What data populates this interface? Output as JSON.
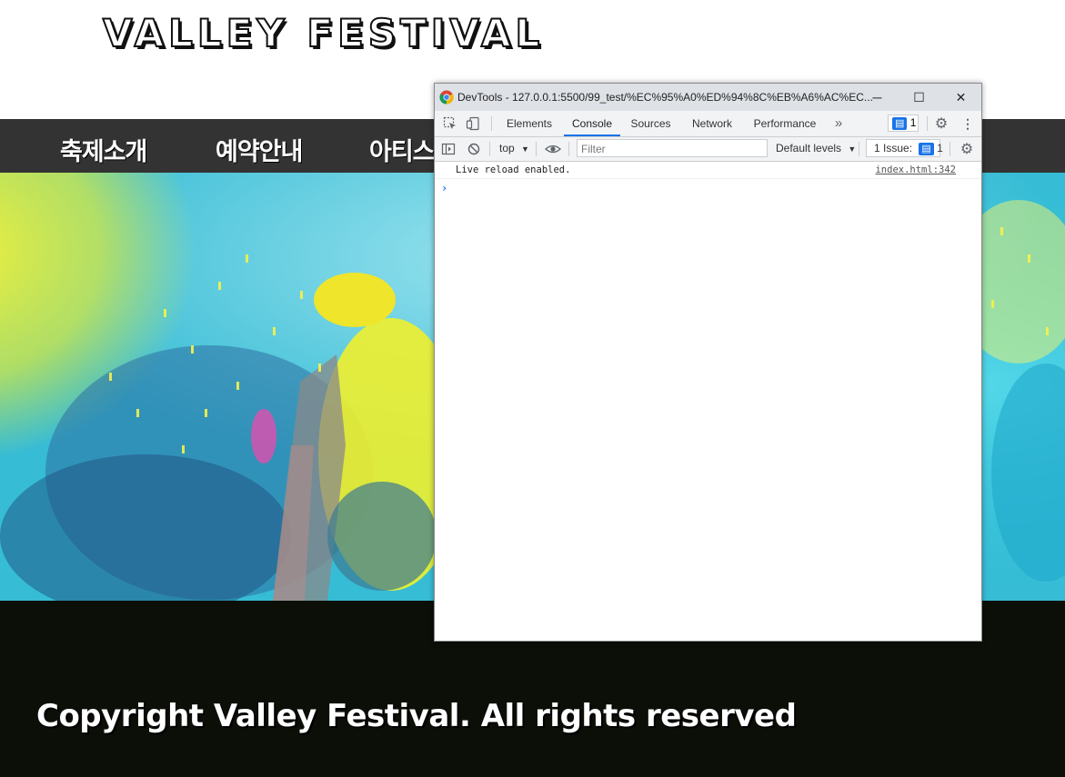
{
  "site": {
    "logo": "VALLEY FESTIVAL",
    "nav": [
      "축제소개",
      "예약안내",
      "아티스"
    ],
    "footer_text": "Copyright Valley Festival. All rights reserved",
    "colors": {
      "nav_bg": "#333333",
      "footer_bg": "#0b0f07",
      "hero_accent_yellow": "#e8ef2a",
      "hero_accent_cyan": "#2fbfd6"
    }
  },
  "devtools": {
    "title": "DevTools - 127.0.0.1:5500/99_test/%EC%95%A0%ED%94%8C%EB%A6%AC%EC...",
    "window_controls": {
      "minimize": "─",
      "maximize": "☐",
      "close": "✕"
    },
    "tabs": [
      "Elements",
      "Console",
      "Sources",
      "Network",
      "Performance"
    ],
    "active_tab": "Console",
    "more_tabs": "»",
    "messages_count": "1",
    "toolbar": {
      "context": "top",
      "filter_placeholder": "Filter",
      "levels": "Default levels",
      "issues_label": "1 Issue:",
      "issues_count": "1"
    },
    "console": [
      {
        "text": "Live reload enabled.",
        "source": "index.html:342"
      }
    ],
    "prompt": "›"
  }
}
